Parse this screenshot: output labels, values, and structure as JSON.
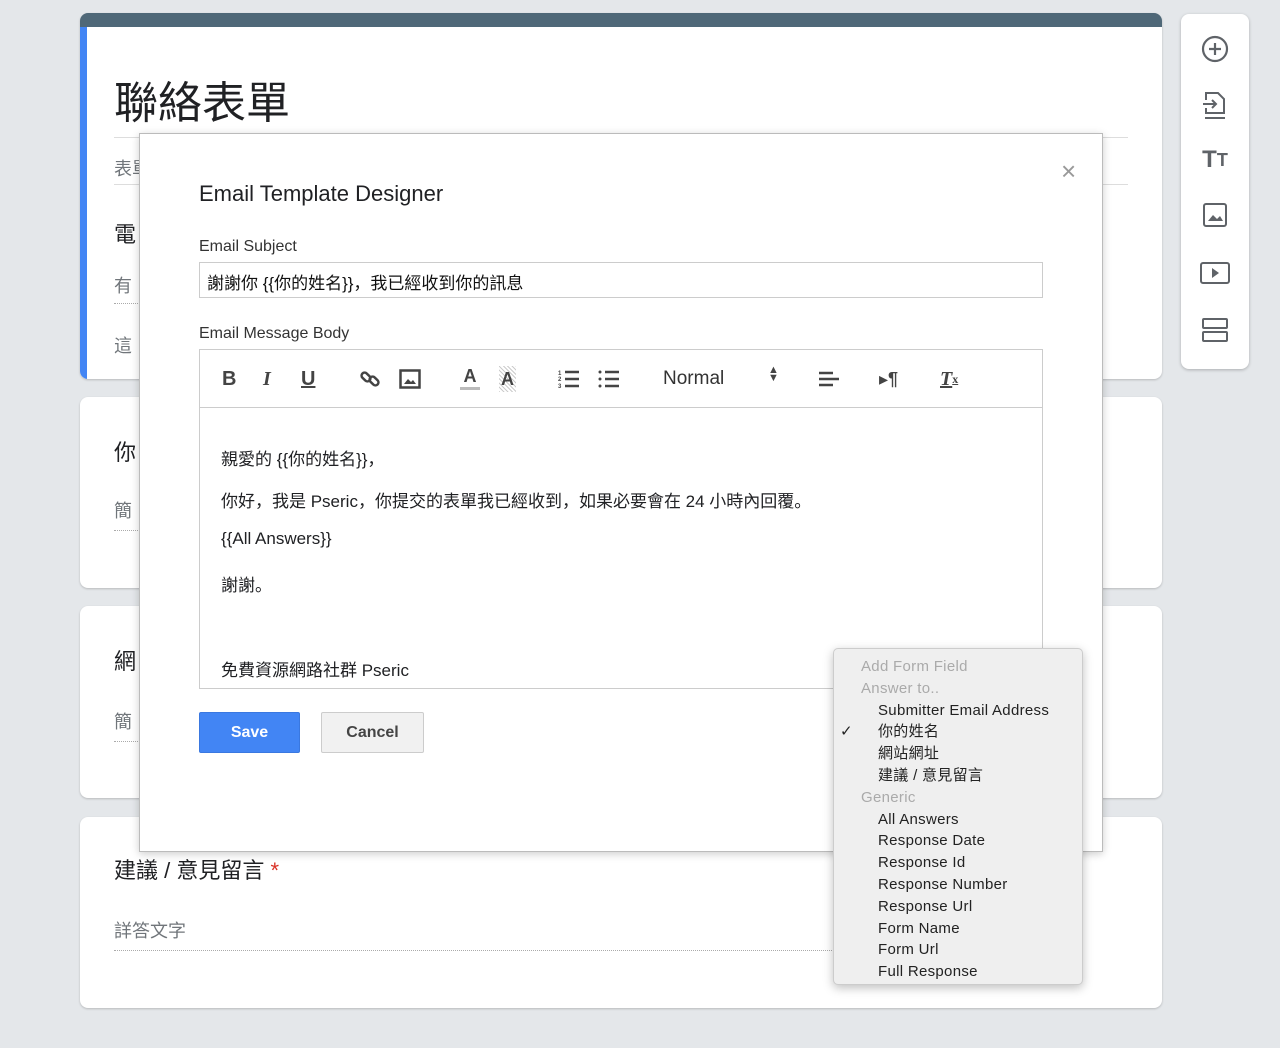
{
  "form": {
    "title": "聯絡表單",
    "fragments": [
      "表單",
      "電",
      "有",
      "這",
      "你",
      "簡",
      "網",
      "簡"
    ],
    "question4": {
      "title": "建議 / 意見留言",
      "required_mark": "*",
      "placeholder": "詳答文字"
    }
  },
  "sidebar": {
    "icons": [
      "add-circle-icon",
      "import-icon",
      "title-icon",
      "image-icon",
      "video-icon",
      "section-icon"
    ]
  },
  "modal": {
    "title": "Email Template Designer",
    "close": "×",
    "subject_label": "Email Subject",
    "subject_value": "謝謝你 {{你的姓名}}，我已經收到你的訊息",
    "body_label": "Email Message Body",
    "toolbar": {
      "bold": "B",
      "italic": "I",
      "underline": "U",
      "format": "Normal"
    },
    "body_lines": [
      "親愛的 {{你的姓名}}，",
      "你好，我是 Pseric，你提交的表單我已經收到，如果必要會在 24 小時內回覆。",
      "{{All Answers}}",
      "謝謝。",
      "免費資源網路社群 Pseric"
    ],
    "save": "Save",
    "cancel": "Cancel"
  },
  "dropdown": {
    "header": "Add Form Field",
    "group1": "Answer to..",
    "answers": [
      "Submitter Email Address",
      "你的姓名",
      "網站網址",
      "建議 / 意見留言"
    ],
    "checked": "你的姓名",
    "check": "✓",
    "group2": "Generic",
    "generic": [
      "All Answers",
      "Response Date",
      "Response Id",
      "Response Number",
      "Response Url",
      "Form Name",
      "Form Url",
      "Full Response"
    ]
  },
  "colors": {
    "accent": "#4285f4",
    "header": "#4f6878"
  }
}
